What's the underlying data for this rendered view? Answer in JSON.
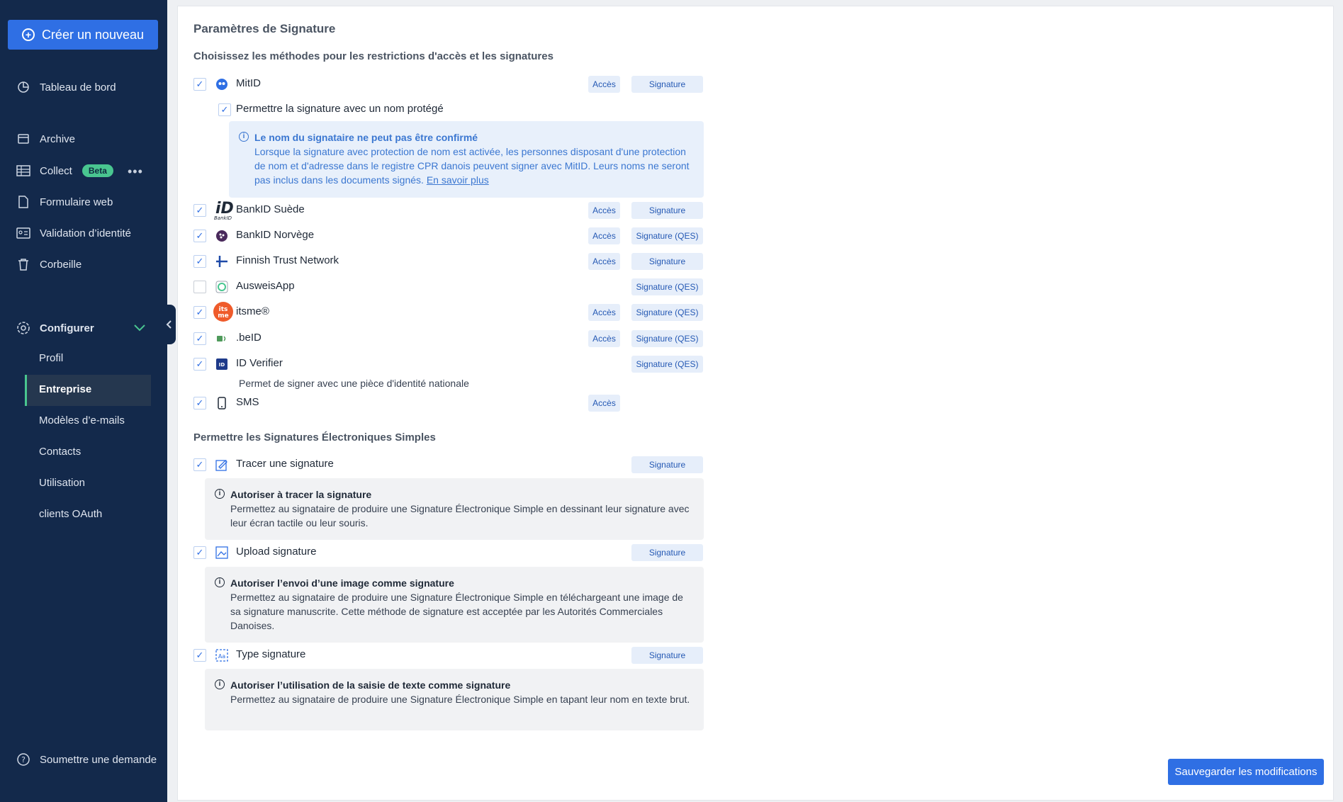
{
  "sidebar": {
    "create_label": "Créer un nouveau",
    "nav": {
      "dashboard": "Tableau de bord",
      "archive": "Archive",
      "collect": "Collect",
      "collect_badge": "Beta",
      "webform": "Formulaire web",
      "identity": "Validation d’identité",
      "trash": "Corbeille",
      "configure": "Configurer",
      "support": "Soumettre une demande"
    },
    "sub": {
      "profile": "Profil",
      "company": "Entreprise",
      "email_templates": "Modèles d’e-mails",
      "contacts": "Contacts",
      "usage": "Utilisation",
      "oauth": "clients OAuth"
    }
  },
  "main": {
    "title": "Paramètres de Signature",
    "methods_heading": "Choisissez les méthodes pour les restrictions d'accès et les signatures",
    "methods": [
      {
        "label": "MitID",
        "checked": true,
        "access": "Accès",
        "signature": "Signature"
      },
      {
        "label": "BankID Suède",
        "checked": true,
        "access": "Accès",
        "signature": "Signature"
      },
      {
        "label": "BankID Norvège",
        "checked": true,
        "access": "Accès",
        "signature": "Signature (QES)"
      },
      {
        "label": "Finnish Trust Network",
        "checked": true,
        "access": "Accès",
        "signature": "Signature"
      },
      {
        "label": "AusweisApp",
        "checked": false,
        "signature": "Signature (QES)"
      },
      {
        "label": "itsme®",
        "checked": true,
        "access": "Accès",
        "signature": "Signature (QES)"
      },
      {
        "label": ".beID",
        "checked": true,
        "access": "Accès",
        "signature": "Signature (QES)"
      },
      {
        "label": "ID Verifier",
        "checked": true,
        "signature": "Signature (QES)"
      },
      {
        "label": "SMS",
        "checked": true,
        "access": "Accès"
      }
    ],
    "mitid_protected": "Permettre la signature avec un nom protégé",
    "mitid_info_title": "Le nom du signataire ne peut pas être confirmé",
    "mitid_info_body": "Lorsque la signature avec protection de nom est activée, les personnes disposant d'une protection de nom et d'adresse dans le registre CPR danois peuvent signer avec MitID. Leurs noms ne seront pas inclus dans les documents signés.",
    "mitid_info_link": "En savoir plus",
    "idverifier_note": "Permet de signer avec une pièce d'identité nationale",
    "ses_heading": "Permettre les Signatures Électroniques Simples",
    "ses": [
      {
        "label": "Tracer une signature",
        "signature": "Signature",
        "info_title": "Autoriser à tracer la signature",
        "info_body": "Permettez au signataire de produire une Signature Électronique Simple en dessinant leur signature avec leur écran tactile ou leur souris."
      },
      {
        "label": "Upload signature",
        "signature": "Signature",
        "info_title": "Autoriser l’envoi d’une image comme signature",
        "info_body": "Permettez au signataire de produire une Signature Électronique Simple en téléchargeant une image de sa signature manuscrite. Cette méthode de signature est acceptée par les Autorités Commerciales Danoises."
      },
      {
        "label": "Type signature",
        "signature": "Signature",
        "info_title": "Autoriser l’utilisation de la saisie de texte comme signature",
        "info_body": "Permettez au signataire de produire une Signature Électronique Simple en tapant leur nom en texte brut."
      }
    ],
    "save_label": "Sauvegarder les modifications"
  },
  "icons": [
    "plus-circle-icon",
    "pie-chart-icon",
    "archive-icon",
    "table-icon",
    "document-icon",
    "id-card-icon",
    "trash-icon",
    "gear-icon",
    "question-icon",
    "chevron-down-icon",
    "chevron-left-icon",
    "info-icon",
    "check-icon"
  ],
  "colors": {
    "sidebar": "#13294b",
    "primary": "#2f6fe4",
    "accent_green": "#49c690",
    "tag_bg": "#e6eefa"
  }
}
